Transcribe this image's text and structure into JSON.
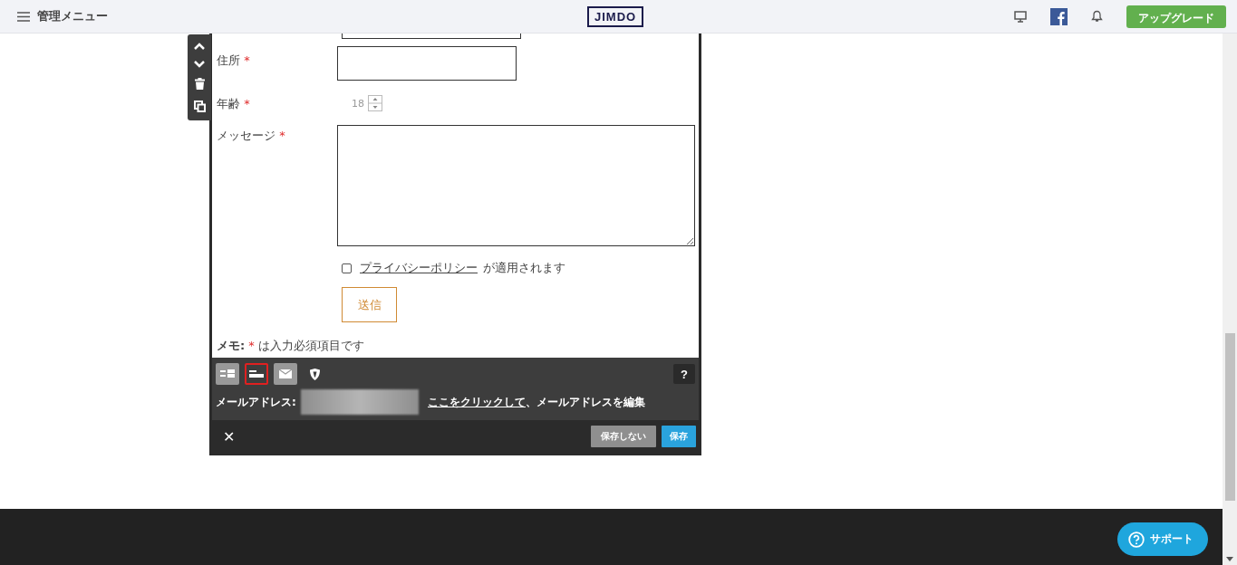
{
  "top_bar": {
    "menu_label": "管理メニュー",
    "logo": "JIMDO",
    "upgrade_button": "アップグレード"
  },
  "form": {
    "fields": [
      {
        "kind": "text",
        "label": "住所",
        "required": true
      },
      {
        "kind": "number",
        "label": "年齢",
        "required": true,
        "value": "18"
      },
      {
        "kind": "textarea",
        "label": "メッセージ",
        "required": true
      }
    ],
    "privacy": {
      "checked": false,
      "link": "プライバシーポリシー",
      "text": "が適用されます"
    },
    "submit_button": "送信",
    "memo": {
      "label": "メモ:",
      "mark": "*",
      "text": "は入力必須項目です"
    }
  },
  "toolbar": {
    "tabs": [
      {
        "kind": "columns",
        "selected": false
      },
      {
        "kind": "rows",
        "selected": true
      },
      {
        "kind": "mail",
        "selected": false
      },
      {
        "kind": "shield",
        "selected": false
      }
    ],
    "help": "?",
    "email_label": "メールアドレス:",
    "edit_link": "ここをクリックして",
    "edit_text": "、メールアドレスを編集"
  },
  "actions": {
    "close": "✕",
    "cancel_button": "保存しない",
    "save_button": "保存"
  },
  "support_button": "サポート"
}
